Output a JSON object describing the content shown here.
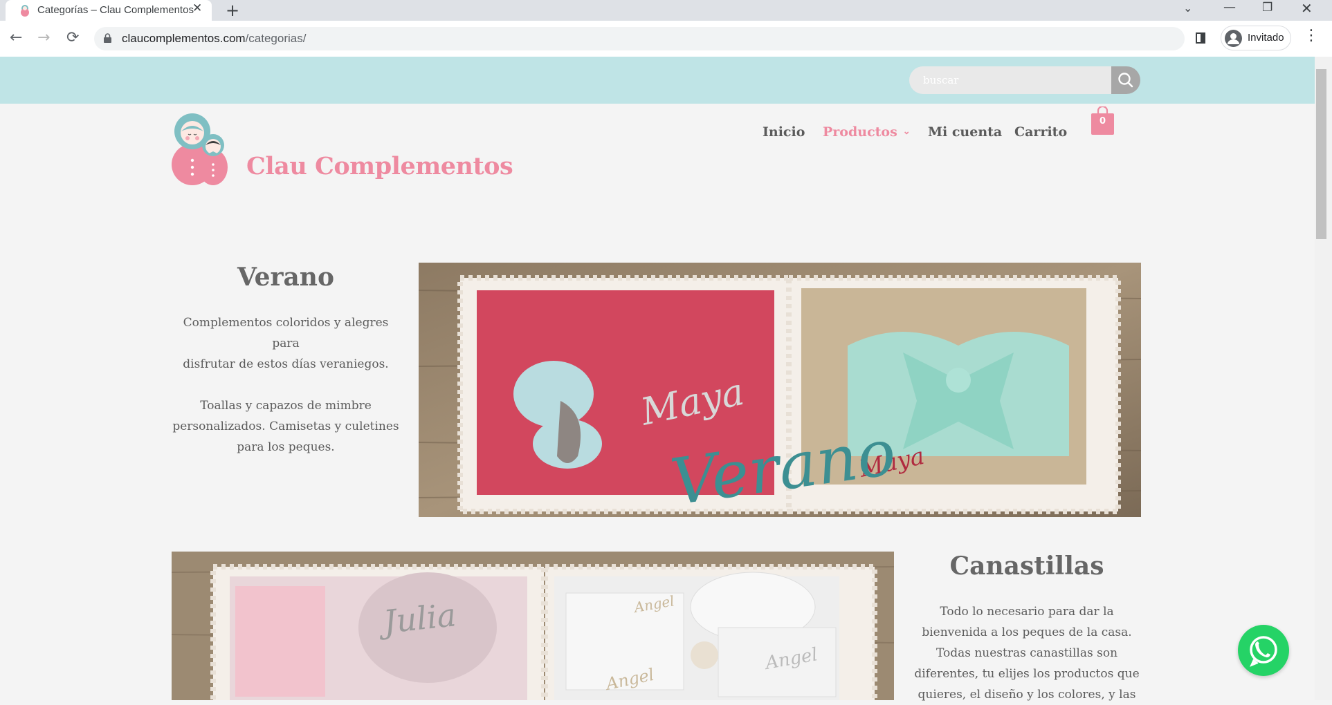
{
  "browser": {
    "tab_title": "Categorías – Clau Complementos",
    "url_host": "claucomplementos.com",
    "url_path": "/categorias/",
    "profile_label": "Invitado"
  },
  "site": {
    "search_placeholder": "buscar",
    "brand_name": "Clau Complementos",
    "nav": {
      "inicio": "Inicio",
      "productos": "Productos",
      "mi_cuenta": "Mi cuenta",
      "carrito": "Carrito"
    },
    "cart_count": "0",
    "colors": {
      "accent_pink": "#ee8aa0",
      "topbar_teal": "#bfe4e6",
      "whatsapp_green": "#25d366"
    }
  },
  "categories": [
    {
      "title": "Verano",
      "paragraphs": [
        [
          "Complementos coloridos y alegres para",
          "disfrutar de estos días veraniegos."
        ],
        [
          "Toallas y capazos de mimbre",
          "personalizados. Camisetas y culetines",
          "para los peques."
        ]
      ],
      "banner_text": [
        "Maya",
        "Maya",
        "Verano"
      ]
    },
    {
      "title": "Canastillas",
      "paragraphs": [
        [
          "Todo lo necesario para  dar la",
          "bienvenida a los peques de la casa.",
          "Todas nuestras canastillas son",
          "diferentes, tu elijes los productos que",
          "quieres, el diseño y los colores, y las"
        ]
      ],
      "banner_text": [
        "Julia",
        "Angel",
        "Angel",
        "Angel"
      ]
    }
  ]
}
